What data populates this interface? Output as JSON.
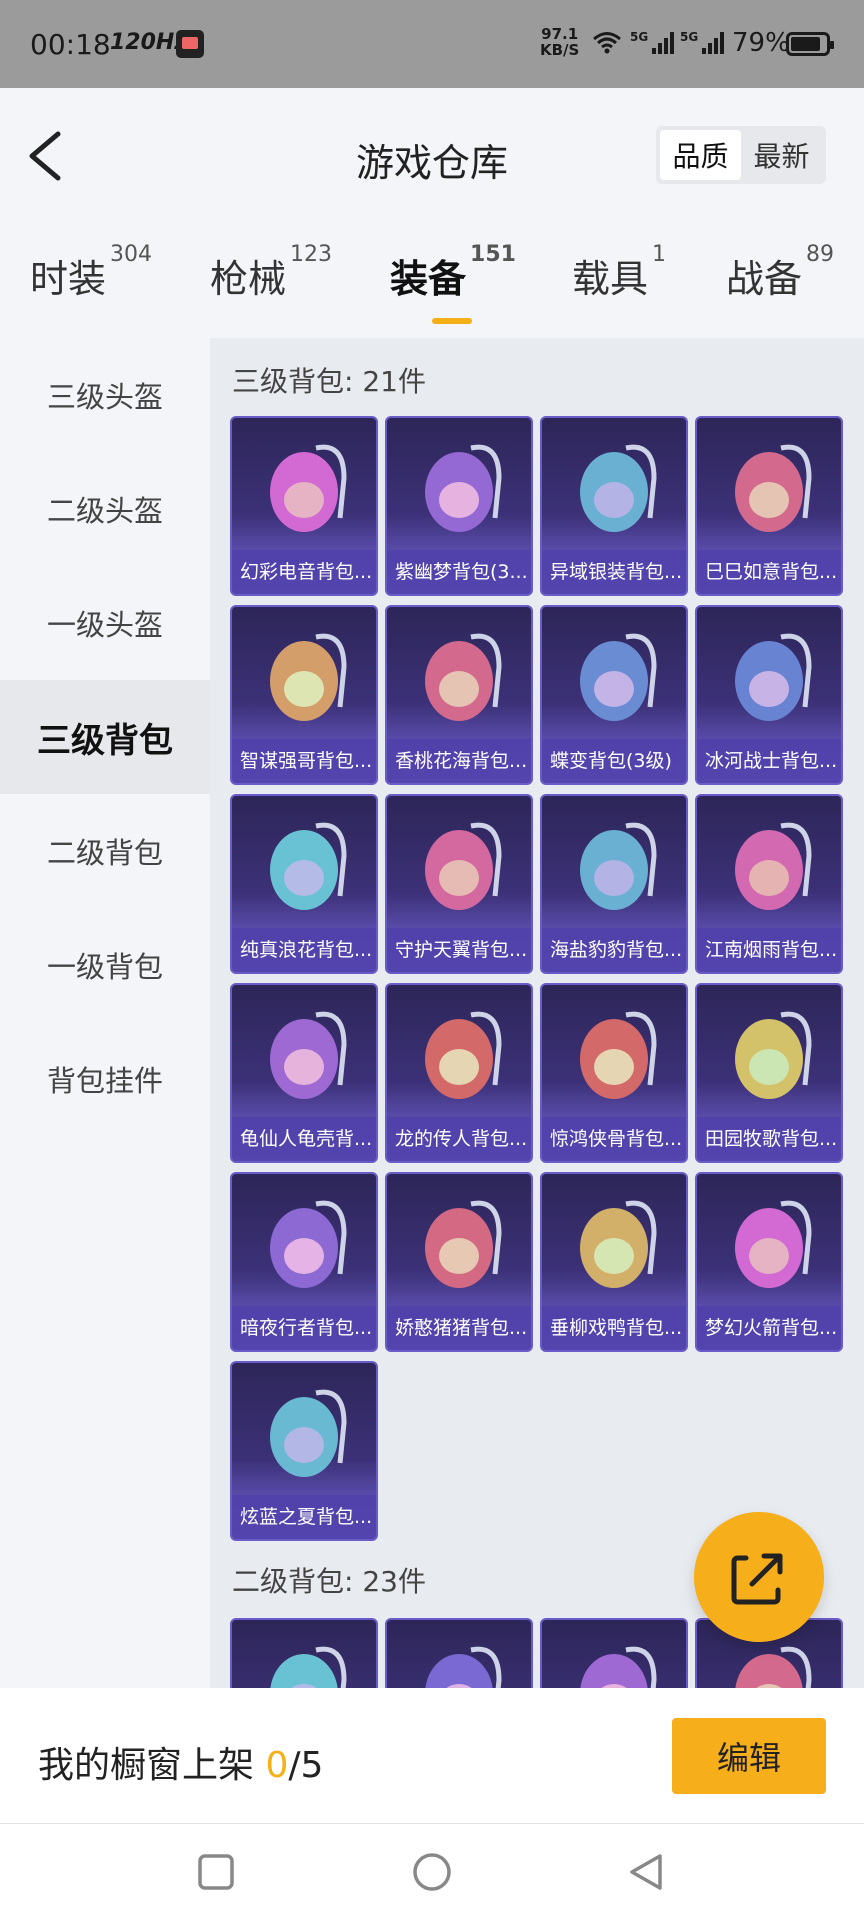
{
  "status_bar": {
    "time": "00:18",
    "refresh": "120Hz",
    "net_speed_value": "97.1",
    "net_speed_unit": "KB/S",
    "sim1": "5G",
    "sim2": "5G",
    "battery": "79%"
  },
  "header": {
    "title": "游戏仓库",
    "sort_options": [
      "品质",
      "最新"
    ],
    "sort_selected": "品质"
  },
  "tabs": [
    {
      "label": "时装",
      "count": "304"
    },
    {
      "label": "枪械",
      "count": "123"
    },
    {
      "label": "装备",
      "count": "151"
    },
    {
      "label": "载具",
      "count": "1"
    },
    {
      "label": "战备",
      "count": "89"
    }
  ],
  "active_tab": "装备",
  "side_nav": [
    "三级头盔",
    "二级头盔",
    "一级头盔",
    "三级背包",
    "二级背包",
    "一级背包",
    "背包挂件"
  ],
  "side_nav_active": "三级背包",
  "sections": [
    {
      "title": "三级背包: 21件",
      "items": [
        "幻彩电音背包...",
        "紫幽梦背包(3...",
        "异域银装背包...",
        "巳巳如意背包...",
        "智谋强哥背包...",
        "香桃花海背包...",
        "蝶变背包(3级)",
        "冰河战士背包...",
        "纯真浪花背包...",
        "守护天翼背包...",
        "海盐豹豹背包...",
        "江南烟雨背包...",
        "龟仙人龟壳背...",
        "龙的传人背包...",
        "惊鸿侠骨背包...",
        "田园牧歌背包...",
        "暗夜行者背包...",
        "娇憨猪猪背包...",
        "垂柳戏鸭背包...",
        "梦幻火箭背包...",
        "炫蓝之夏背包..."
      ]
    },
    {
      "title": "二级背包: 23件",
      "items": []
    }
  ],
  "colors": {
    "accent": "#f6ae1a",
    "card_bg_top": "#2d2658",
    "card_bg_bottom": "#7a6ad0"
  },
  "bottom_bar": {
    "shelf_label": "我的橱窗上架",
    "shelf_current": "0",
    "shelf_total": "/5",
    "edit_label": "编辑"
  },
  "icons": {
    "back": "chevron-left-icon",
    "fab": "share-external-icon",
    "nav_recent": "square-icon",
    "nav_home": "circle-icon",
    "nav_back": "triangle-back-icon"
  }
}
